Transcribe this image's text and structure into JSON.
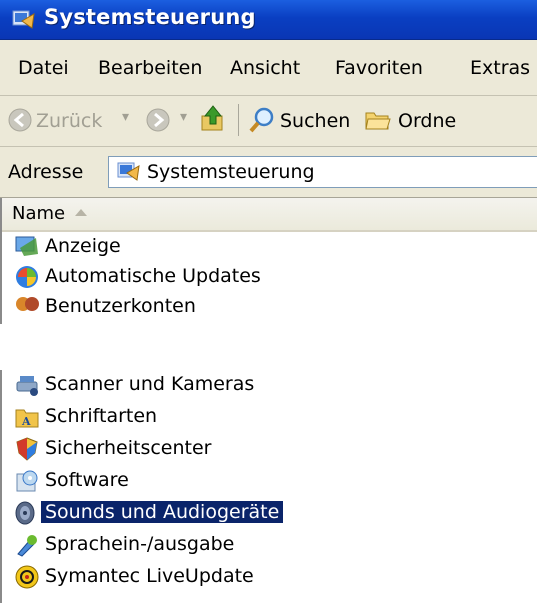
{
  "window": {
    "title": "Systemsteuerung"
  },
  "menu": {
    "items": [
      "Datei",
      "Bearbeiten",
      "Ansicht",
      "Favoriten",
      "Extras"
    ]
  },
  "toolbar": {
    "back_label": "Zurück",
    "search_label": "Suchen",
    "folders_label": "Ordne"
  },
  "address": {
    "label": "Adresse",
    "value": "Systemsteuerung"
  },
  "list": {
    "column_name": "Name",
    "top_items": [
      "Anzeige",
      "Automatische Updates",
      "Benutzerkonten"
    ],
    "bottom_items": [
      "Scanner und Kameras",
      "Schriftarten",
      "Sicherheitscenter",
      "Software",
      "Sounds und Audiogeräte",
      "Sprachein-/ausgabe",
      "Symantec LiveUpdate"
    ],
    "selected_item": "Sounds und Audiogeräte"
  },
  "colors": {
    "titlebar": "#0a3fc2",
    "selection": "#0a246a",
    "chrome": "#ece9d8"
  }
}
